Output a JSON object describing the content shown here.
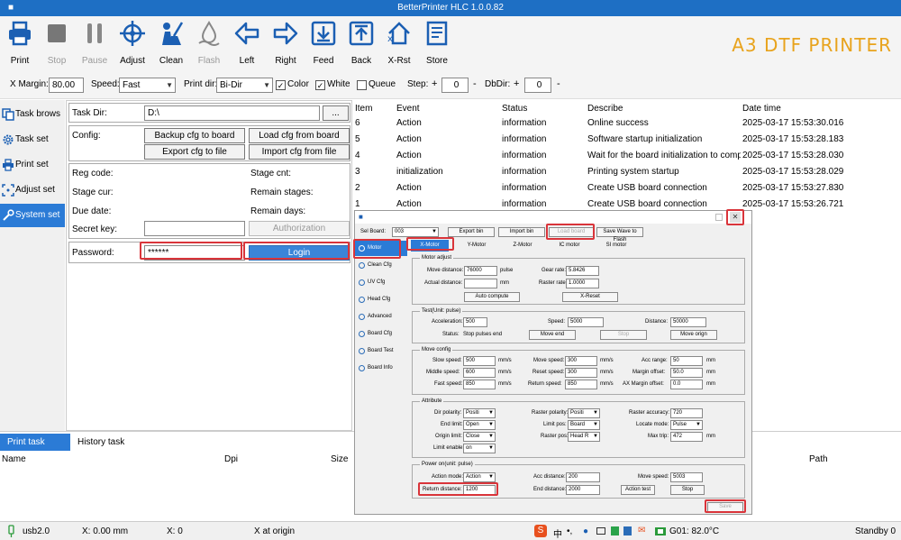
{
  "window": {
    "title": "BetterPrinter HLC 1.0.0.82"
  },
  "toolbar": {
    "items": [
      {
        "label": "Print",
        "enabled": true
      },
      {
        "label": "Stop",
        "enabled": false
      },
      {
        "label": "Pause",
        "enabled": false
      },
      {
        "label": "Adjust",
        "enabled": true
      },
      {
        "label": "Clean",
        "enabled": true
      },
      {
        "label": "Flash",
        "enabled": false
      },
      {
        "label": "Left",
        "enabled": true
      },
      {
        "label": "Right",
        "enabled": true
      },
      {
        "label": "Feed",
        "enabled": true
      },
      {
        "label": "Back",
        "enabled": true
      },
      {
        "label": "X-Rst",
        "enabled": true
      },
      {
        "label": "Store",
        "enabled": true
      }
    ],
    "brand": "A3 DTF PRINTER"
  },
  "options": {
    "x_margin_label": "X Margin:",
    "x_margin_value": "80.00",
    "speed_label": "Speed:",
    "speed_value": "Fast",
    "print_dir_label": "Print dir:",
    "print_dir_value": "Bi-Dir",
    "color_label": "Color",
    "white_label": "White",
    "queue_label": "Queue",
    "step_label": "Step:",
    "step_value": "0",
    "dbdir_label": "DbDir:",
    "dbdir_value": "0",
    "plus": "+",
    "minus": "-"
  },
  "sidebar": {
    "items": [
      {
        "label": "Task brows",
        "icon": "copy-icon"
      },
      {
        "label": "Task set",
        "icon": "gear-icon"
      },
      {
        "label": "Print set",
        "icon": "printer-icon"
      },
      {
        "label": "Adjust set",
        "icon": "target-icon"
      },
      {
        "label": "System set",
        "icon": "wrench-icon"
      }
    ]
  },
  "config": {
    "task_dir_label": "Task Dir:",
    "task_dir_value": "D:\\",
    "browse": "...",
    "config_label": "Config:",
    "backup": "Backup cfg to board",
    "load": "Load cfg from board",
    "export": "Export cfg to file",
    "import": "Import cfg from file",
    "reg_code": "Reg code:",
    "stage_cnt": "Stage cnt:",
    "stage_cur": "Stage cur:",
    "remain_stages": "Remain stages:",
    "due_date": "Due date:",
    "remain_days": "Remain days:",
    "secret_key": "Secret key:",
    "authorization": "Authorization",
    "password_label": "Password:",
    "password_value": "******",
    "login": "Login"
  },
  "log": {
    "headers": [
      "Item",
      "Event",
      "Status",
      "Describe",
      "Date time"
    ],
    "rows": [
      [
        "6",
        "Action",
        "information",
        "Online success",
        "2025-03-17 15:53:30.016"
      ],
      [
        "5",
        "Action",
        "information",
        "Software startup initialization",
        "2025-03-17 15:53:28.183"
      ],
      [
        "4",
        "Action",
        "information",
        "Wait for the board initialization to comple",
        "2025-03-17 15:53:28.030"
      ],
      [
        "3",
        "initialization",
        "information",
        "Printing system startup",
        "2025-03-17 15:53:28.029"
      ],
      [
        "2",
        "Action",
        "information",
        "Create USB board connection",
        "2025-03-17 15:53:27.830"
      ],
      [
        "1",
        "Action",
        "information",
        "Create USB board connection",
        "2025-03-17 15:53:26.721"
      ]
    ]
  },
  "tasks": {
    "tabs": [
      "Print task",
      "History task"
    ],
    "headers": [
      "Name",
      "Dpi",
      "Size",
      "Path"
    ]
  },
  "status": {
    "usb": "usb2.0",
    "x_pos": "X: 0.00 mm",
    "x_count": "X: 0",
    "x_origin": "X at origin",
    "temp": "G01: 82.0°C",
    "standby": "Standby  0",
    "ime": "中",
    "ime_punct": "•,"
  },
  "dialog": {
    "sel_board_label": "Sel Board:",
    "sel_board_value": "003",
    "export_bin": "Export bin",
    "import_bin": "Import bin",
    "load_board": "Load board",
    "save_wave": "Save Wave to Flash",
    "side": [
      "Motor",
      "Clean Cfg",
      "UV Cfg",
      "Head Cfg",
      "Advanced",
      "Board Cfg",
      "Board Test",
      "Board Info"
    ],
    "tabs": [
      "X-Motor",
      "Y-Motor",
      "Z-Motor",
      "IC motor",
      "SI motor"
    ],
    "motor_adjust": {
      "title": "Motor adjust",
      "move_distance_label": "Move distance:",
      "move_distance": "76000",
      "pulse": "pulse",
      "gear_rate_label": "Gear rate:",
      "gear_rate": "5.8426",
      "actual_distance_label": "Actual distance:",
      "actual_distance": "",
      "mm": "mm",
      "raster_rate_label": "Raster rate:",
      "raster_rate": "1.0000",
      "auto_compute": "Auto compute",
      "x_reset": "X-Reset"
    },
    "test": {
      "title": "Test(Unit: pulse)",
      "acceleration_label": "Acceleration:",
      "acceleration": "500",
      "speed_label": "Speed:",
      "speed": "5000",
      "distance_label": "Distance:",
      "distance": "50000",
      "status_label": "Status:",
      "status": "Stop pulses end",
      "move_end": "Move end",
      "stop": "Stop",
      "move_origin": "Move orign"
    },
    "move_config": {
      "title": "Move config",
      "slow_speed_label": "Slow speed:",
      "slow_speed": "500",
      "move_speed_label": "Move speed:",
      "move_speed": "300",
      "acc_range_label": "Acc range:",
      "acc_range": "50",
      "middle_speed_label": "Middle speed:",
      "middle_speed": "600",
      "reset_speed_label": "Reset speed:",
      "reset_speed": "300",
      "margin_offset_label": "Margin offset:",
      "margin_offset": "50.0",
      "fast_speed_label": "Fast speed:",
      "fast_speed": "850",
      "return_speed_label": "Return speed:",
      "return_speed": "850",
      "ax_margin_offset_label": "AX Margin offset:",
      "ax_margin_offset": "0.0",
      "mms": "mm/s",
      "mm": "mm"
    },
    "attribute": {
      "title": "Attribute",
      "dir_polarity_label": "Dir polarity:",
      "dir_polarity": "Positi",
      "raster_polarity_label": "Raster polarity:",
      "raster_polarity": "Positi",
      "raster_accuracy_label": "Raster accuracy:",
      "raster_accuracy": "720",
      "end_limit_label": "End limit:",
      "end_limit": "Open",
      "limit_pos_label": "Limit pos:",
      "limit_pos": "Board",
      "locate_mode_label": "Locate mode:",
      "locate_mode": "Pulse",
      "origin_limit_label": "Origin limit:",
      "origin_limit": "Close",
      "raster_pos_label": "Raster pos:",
      "raster_pos": "Head R",
      "max_trip_label": "Max trip:",
      "max_trip": "472",
      "mm": "mm",
      "limit_enable_label": "Limit enable:",
      "limit_enable": "on"
    },
    "power_on": {
      "title": "Power on(unit: pulse)",
      "action_mode_label": "Action mode:",
      "action_mode": "Action",
      "acc_distance_label": "Acc distance:",
      "acc_distance": "200",
      "move_speed_label": "Move speed:",
      "move_speed": "5003",
      "return_distance_label": "Return distance:",
      "return_distance": "1200",
      "end_distance_label": "End distance:",
      "end_distance": "2000",
      "action_test": "Action test",
      "stop": "Stop"
    },
    "save": "Save"
  }
}
